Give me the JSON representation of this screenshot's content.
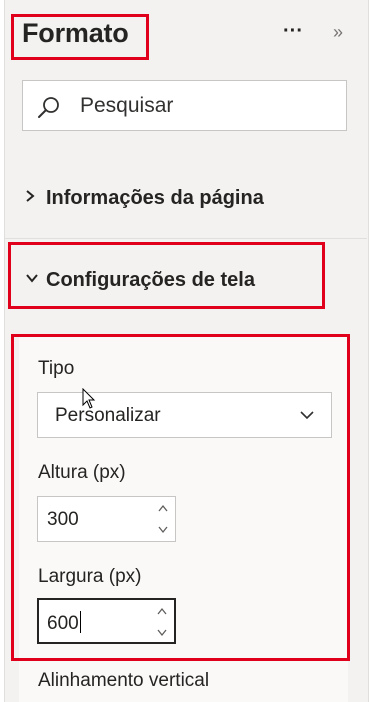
{
  "header": {
    "title": "Formato",
    "more_icon": "ellipsis-icon",
    "more_glyph": "···",
    "collapse_icon": "double-chevron-right-icon",
    "collapse_glyph": "»"
  },
  "search": {
    "placeholder": "Pesquisar",
    "icon": "search-icon"
  },
  "sections": [
    {
      "label": "Informações da página",
      "expanded": false
    },
    {
      "label": "Configurações de tela",
      "expanded": true
    }
  ],
  "canvas_settings": {
    "type_label": "Tipo",
    "type_value": "Personalizar",
    "height_label": "Altura (px)",
    "height_value": "300",
    "width_label": "Largura (px)",
    "width_value": "600",
    "next_label": "Alinhamento vertical"
  },
  "colors": {
    "highlight": "#e0001b",
    "pane_bg": "#f3f2f1"
  }
}
